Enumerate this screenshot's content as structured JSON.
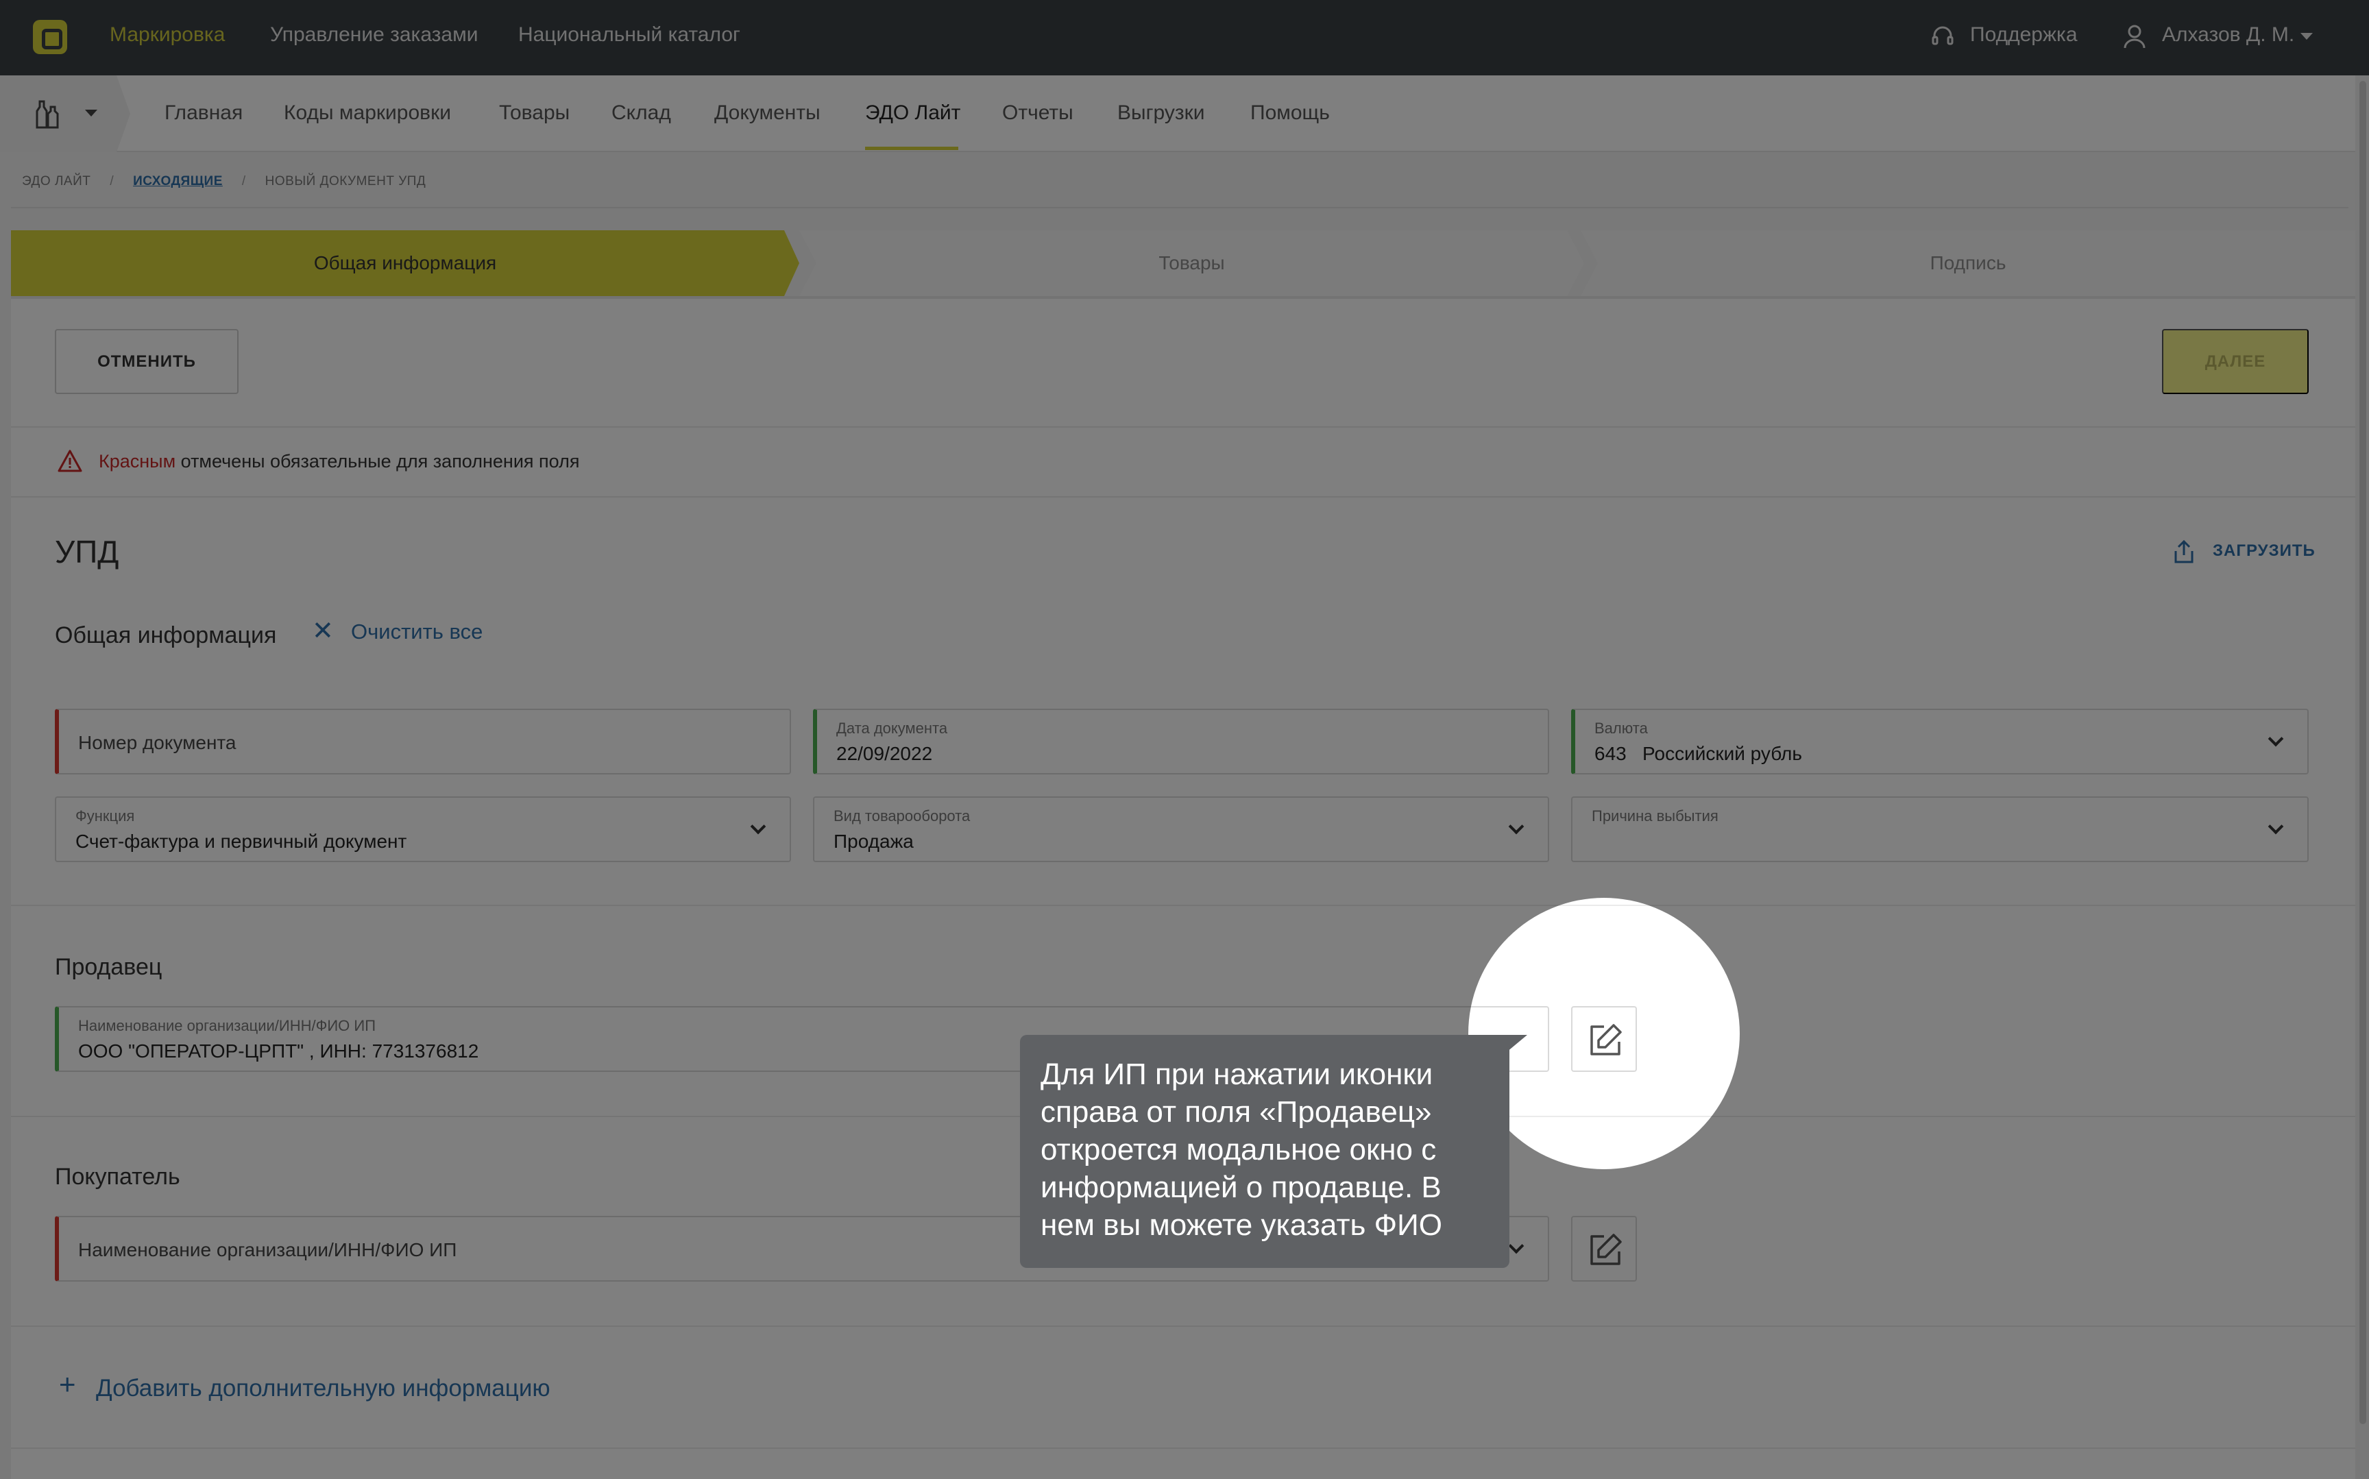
{
  "topbar": {
    "brand_link": "Маркировка",
    "orders_link": "Управление заказами",
    "catalog_link": "Национальный каталог",
    "support": "Поддержка",
    "user": "Алхазов Д. М."
  },
  "nav": {
    "items": [
      "Главная",
      "Коды маркировки",
      "Товары",
      "Склад",
      "Документы",
      "ЭДО Лайт",
      "Отчеты",
      "Выгрузки",
      "Помощь"
    ],
    "active": "ЭДО Лайт"
  },
  "breadcrumb": {
    "root": "эдо лайт",
    "outgoing": "исходящие",
    "current": "новый документ упд"
  },
  "steps": [
    "Общая информация",
    "Товары",
    "Подпись"
  ],
  "actions": {
    "cancel": "ОТМЕНИТЬ",
    "next": "ДАЛЕЕ"
  },
  "notice": {
    "red_word": "Красным",
    "rest": " отмечены обязательные для заполнения поля"
  },
  "document": {
    "title": "УПД",
    "upload": "ЗАГРУЗИТЬ",
    "general_title": "Общая информация",
    "clear_all": "Очистить все"
  },
  "fields": {
    "doc_number": {
      "placeholder": "Номер документа"
    },
    "doc_date": {
      "label": "Дата документа",
      "value": "22/09/2022"
    },
    "currency": {
      "label": "Валюта",
      "value": "643   Российский рубль"
    },
    "function": {
      "label": "Функция",
      "value": "Счет-фактура и первичный документ"
    },
    "turnover": {
      "label": "Вид товарооборота",
      "value": "Продажа"
    },
    "reason": {
      "label": "Причина выбытия",
      "value": ""
    }
  },
  "seller": {
    "title": "Продавец",
    "label": "Наименование организации/ИНН/ФИО ИП",
    "value": "ООО \"ОПЕРАТОР-ЦРПТ\" , ИНН: 7731376812"
  },
  "buyer": {
    "title": "Покупатель",
    "placeholder": "Наименование организации/ИНН/ФИО ИП"
  },
  "add_info": "Добавить дополнительную информацию",
  "tooltip": {
    "lines": [
      "Для ИП при нажатии иконки",
      "справа от поля «Продавец»",
      "откроется модальное окно с",
      "информацией о продавце. В",
      "нем вы можете указать ФИО"
    ]
  },
  "colors": {
    "accent": "#d6d33a",
    "link": "#2f6ea8",
    "required": "#d8372f",
    "valid": "#4caf50",
    "topbar": "#3b4045"
  }
}
